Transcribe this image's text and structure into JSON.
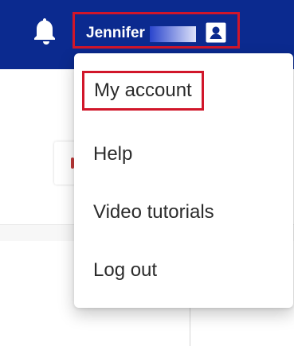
{
  "header": {
    "user_name": "Jennifer"
  },
  "menu": {
    "items": [
      {
        "label": "My account"
      },
      {
        "label": "Help"
      },
      {
        "label": "Video tutorials"
      },
      {
        "label": "Log out"
      }
    ]
  },
  "icons": {
    "bell": "bell-icon",
    "profile": "profile-card-icon"
  },
  "colors": {
    "brand": "#0b2a8f",
    "highlight_outline": "#d1162a"
  }
}
